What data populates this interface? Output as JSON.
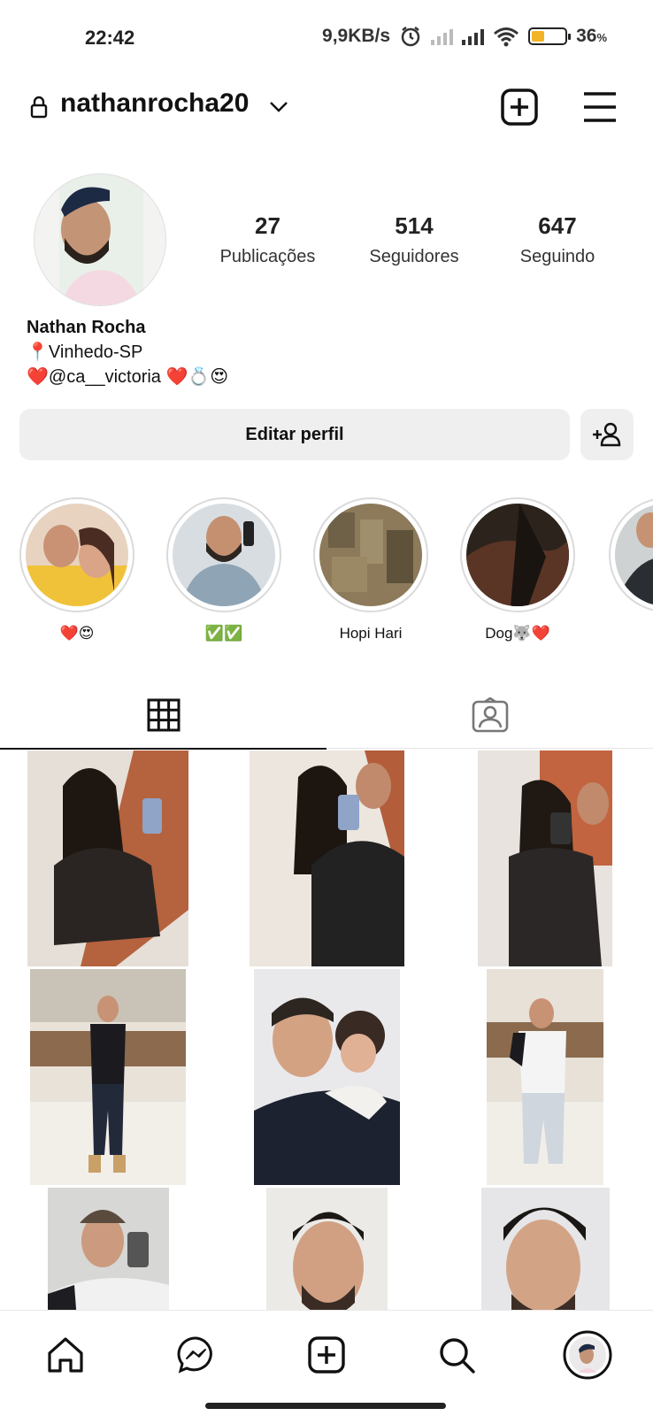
{
  "status_bar": {
    "time": "22:42",
    "speed": "9,9KB/s",
    "battery_percent": "36",
    "battery_unit": "%",
    "battery_level": 0.36
  },
  "header": {
    "username": "nathanrocha20"
  },
  "stats": {
    "posts_count": "27",
    "posts_label": "Publicações",
    "followers_count": "514",
    "followers_label": "Seguidores",
    "following_count": "647",
    "following_label": "Seguindo"
  },
  "bio": {
    "name": "Nathan Rocha",
    "location": "📍Vinhedo-SP",
    "line2": "❤️@ca__victoria ❤️💍😍"
  },
  "buttons": {
    "edit_profile": "Editar perfil"
  },
  "highlights": [
    {
      "label": "❤️😍"
    },
    {
      "label": "✅✅"
    },
    {
      "label": "Hopi Hari"
    },
    {
      "label": "Dog🐺❤️"
    },
    {
      "label": ""
    }
  ],
  "colors": {
    "battery": "#f2b327",
    "button_bg": "#efefef"
  }
}
